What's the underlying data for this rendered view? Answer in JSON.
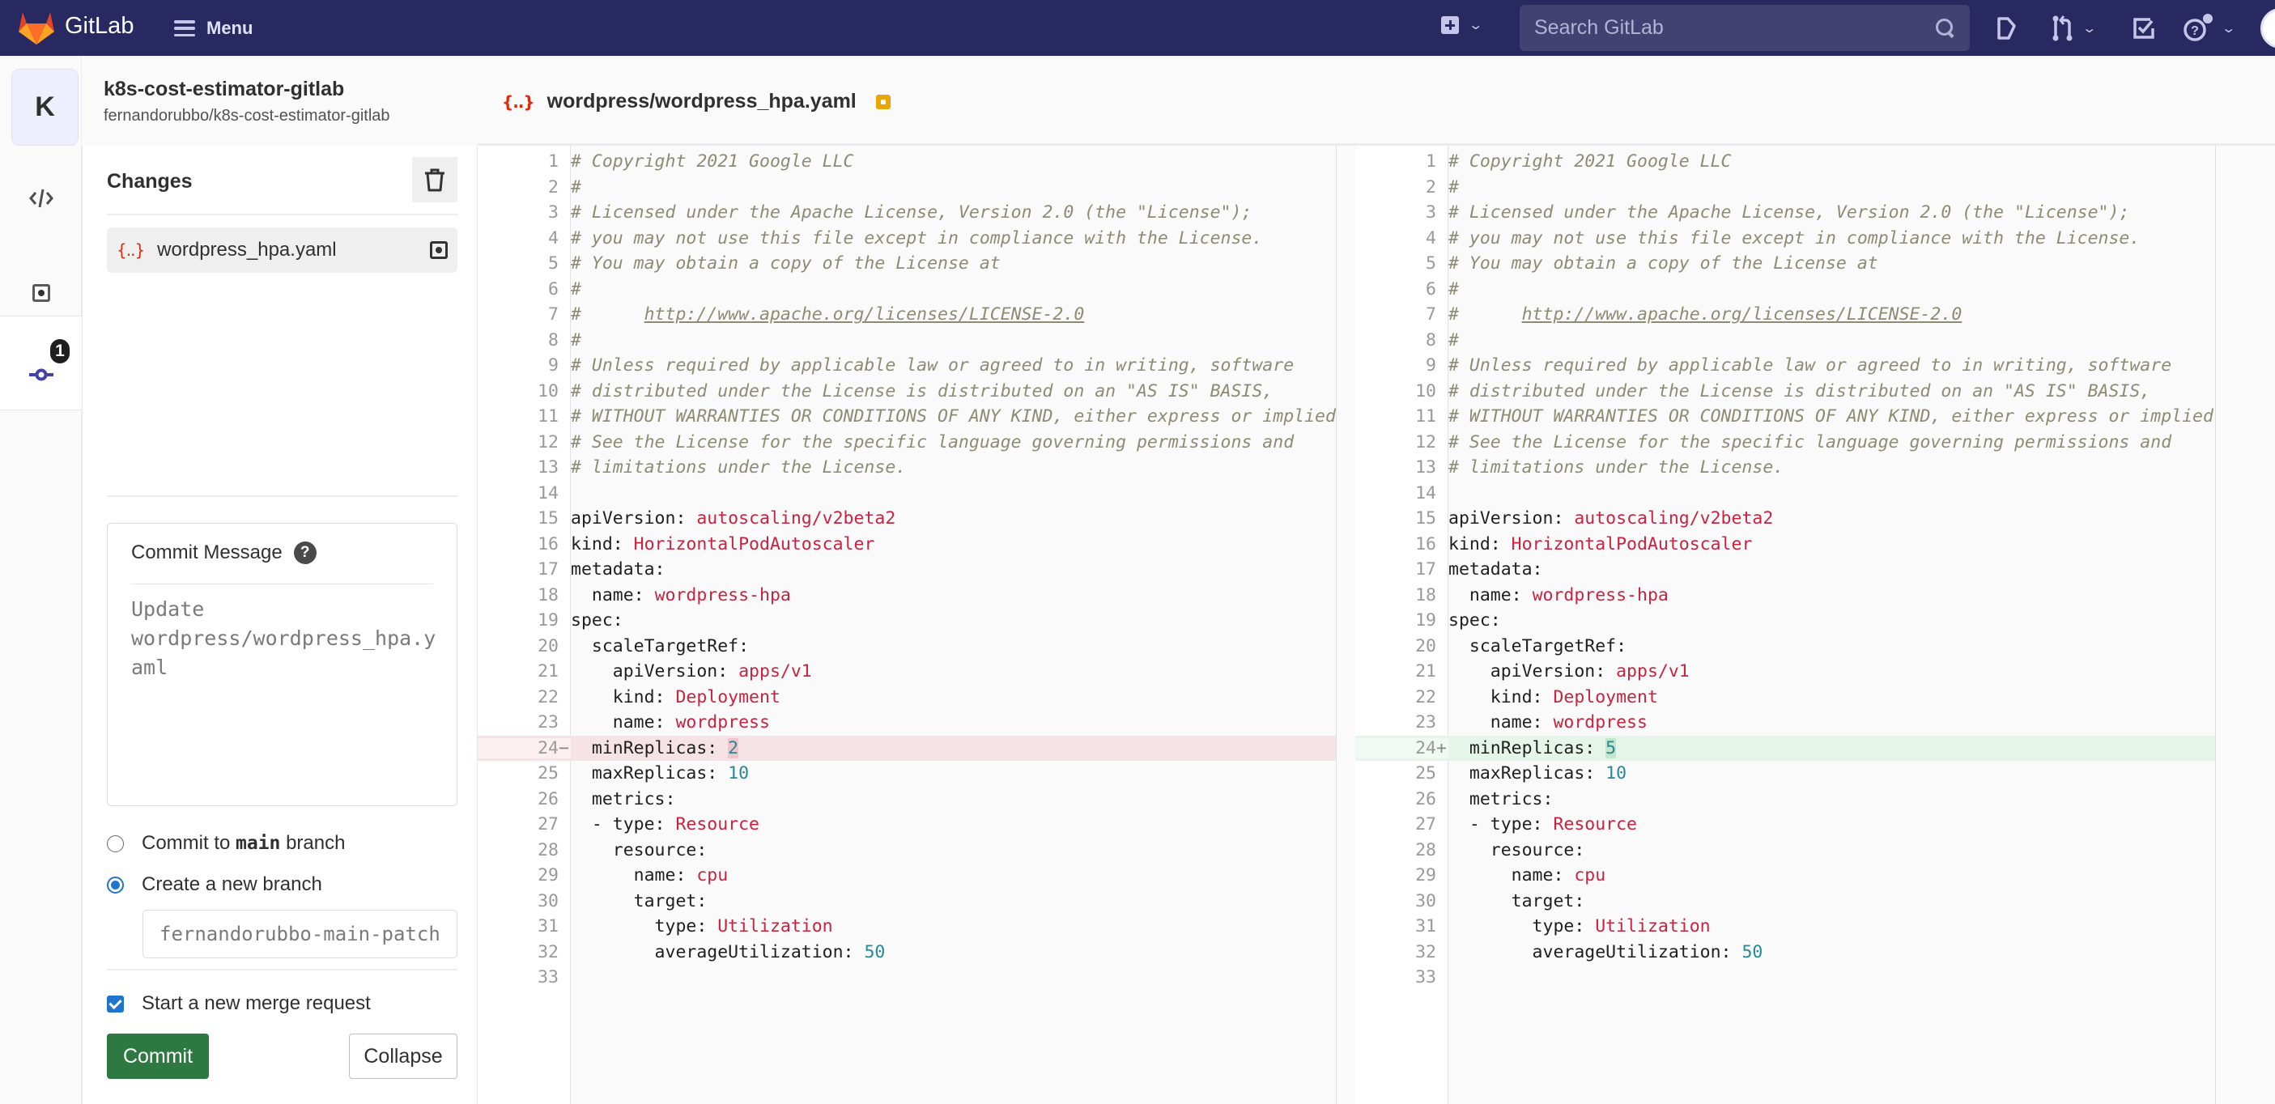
{
  "topbar": {
    "brand": "GitLab",
    "menu_label": "Menu",
    "search_placeholder": "Search GitLab",
    "icons": [
      "plus-square-icon",
      "chevron-down-icon",
      "search-icon",
      "issues-icon",
      "merge-request-icon",
      "todo-icon",
      "help-icon",
      "user-avatar"
    ]
  },
  "project": {
    "avatar_letter": "K",
    "name": "k8s-cost-estimator-gitlab",
    "path": "fernandorubbo/k8s-cost-estimator-gitlab"
  },
  "rail": {
    "items": [
      {
        "name": "edit",
        "icon": "code-icon",
        "active": false
      },
      {
        "name": "review",
        "icon": "file-modified-icon",
        "active": false
      },
      {
        "name": "commit",
        "icon": "commit-icon",
        "active": true,
        "badge": "1"
      }
    ]
  },
  "changes": {
    "title": "Changes",
    "files": [
      {
        "name": "wordpress_hpa.yaml",
        "icon": "yaml-icon",
        "status": "modified"
      }
    ]
  },
  "commit": {
    "message_label": "Commit Message",
    "message_value": "",
    "message_placeholder": "Update wordpress/wordpress_hpa.yaml",
    "option_main_prefix": "Commit to ",
    "option_main_branch": "main",
    "option_main_suffix": " branch",
    "option_main_selected": false,
    "option_new_label": "Create a new branch",
    "option_new_selected": true,
    "branch_value": "",
    "branch_placeholder": "fernandorubbo-main-patch",
    "merge_request_label": "Start a new merge request",
    "merge_request_checked": true,
    "commit_button": "Commit",
    "collapse_button": "Collapse"
  },
  "editor": {
    "file_path": "wordpress/wordpress_hpa.yaml",
    "discard_button": "Discard changes",
    "left_lines": [
      [
        [
          "c",
          "# Copyright 2021 Google LLC"
        ]
      ],
      [
        [
          "c",
          "#"
        ]
      ],
      [
        [
          "c",
          "# Licensed under the Apache License, Version 2.0 (the \"License\");"
        ]
      ],
      [
        [
          "c",
          "# you may not use this file except in compliance with the License."
        ]
      ],
      [
        [
          "c",
          "# You may obtain a copy of the License at"
        ]
      ],
      [
        [
          "c",
          "#"
        ]
      ],
      [
        [
          "c",
          "#      "
        ],
        [
          "u",
          "http://www.apache.org/licenses/LICENSE-2.0"
        ]
      ],
      [
        [
          "c",
          "#"
        ]
      ],
      [
        [
          "c",
          "# Unless required by applicable law or agreed to in writing, software"
        ]
      ],
      [
        [
          "c",
          "# distributed under the License is distributed on an \"AS IS\" BASIS,"
        ]
      ],
      [
        [
          "c",
          "# WITHOUT WARRANTIES OR CONDITIONS OF ANY KIND, either express or implied."
        ]
      ],
      [
        [
          "c",
          "# See the License for the specific language governing permissions and"
        ]
      ],
      [
        [
          "c",
          "# limitations under the License."
        ]
      ],
      [],
      [
        [
          "k",
          "apiVersion: "
        ],
        [
          "s",
          "autoscaling/v2beta2"
        ]
      ],
      [
        [
          "k",
          "kind: "
        ],
        [
          "s",
          "HorizontalPodAutoscaler"
        ]
      ],
      [
        [
          "k",
          "metadata:"
        ]
      ],
      [
        [
          "k",
          "  name: "
        ],
        [
          "s",
          "wordpress-hpa"
        ]
      ],
      [
        [
          "k",
          "spec:"
        ]
      ],
      [
        [
          "k",
          "  scaleTargetRef:"
        ]
      ],
      [
        [
          "k",
          "    apiVersion: "
        ],
        [
          "s",
          "apps/v1"
        ]
      ],
      [
        [
          "k",
          "    kind: "
        ],
        [
          "s",
          "Deployment"
        ]
      ],
      [
        [
          "k",
          "    name: "
        ],
        [
          "s",
          "wordpress"
        ]
      ],
      [
        [
          "k",
          "  minReplicas: "
        ],
        [
          "nd",
          "2"
        ]
      ],
      [
        [
          "k",
          "  maxReplicas: "
        ],
        [
          "n",
          "10"
        ]
      ],
      [
        [
          "k",
          "  metrics:"
        ]
      ],
      [
        [
          "k",
          "  - type: "
        ],
        [
          "s",
          "Resource"
        ]
      ],
      [
        [
          "k",
          "    resource:"
        ]
      ],
      [
        [
          "k",
          "      name: "
        ],
        [
          "s",
          "cpu"
        ]
      ],
      [
        [
          "k",
          "      target:"
        ]
      ],
      [
        [
          "k",
          "        type: "
        ],
        [
          "s",
          "Utilization"
        ]
      ],
      [
        [
          "k",
          "        averageUtilization: "
        ],
        [
          "n",
          "50"
        ]
      ],
      []
    ],
    "right_lines_changed": {
      "24": [
        [
          "k",
          "  minReplicas: "
        ],
        [
          "na",
          "5"
        ]
      ]
    },
    "changed_line": 24,
    "left_marker": "−",
    "right_marker": "+"
  }
}
